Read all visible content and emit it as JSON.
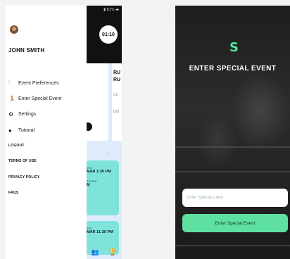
{
  "left_phone": {
    "status": "▮ 81% ▬",
    "timer": "01:10",
    "bg_card_lines": [
      "RU",
      "RU"
    ],
    "bg_small_labels": [
      "CL",
      "DIS"
    ],
    "bg_cards": [
      {
        "label": "INS",
        "value": "MAR 1:30 PM",
        "sub_label": "TANCE",
        "sub_value": "M"
      },
      {
        "label": "INS",
        "value": "MAR 11:30 PM"
      }
    ],
    "user_name": "JOHN SMITH",
    "menu": [
      {
        "icon": "sliders-icon",
        "label": "Event Preferences"
      },
      {
        "icon": "runner-icon",
        "label": "Enter Special Event"
      },
      {
        "icon": "gear-icon",
        "label": "Settings"
      },
      {
        "icon": "help-icon",
        "label": "Tutorial"
      }
    ],
    "links": [
      "LOGOUT",
      "TERMS OF USE",
      "PRIVACY POLICY",
      "FAQS"
    ]
  },
  "right_phone": {
    "title": "ENTER SPECIAL EVENT",
    "code_placeholder": "Enter Special Code",
    "button_label": "Enter Special Event",
    "accent": "#5de0a0"
  }
}
